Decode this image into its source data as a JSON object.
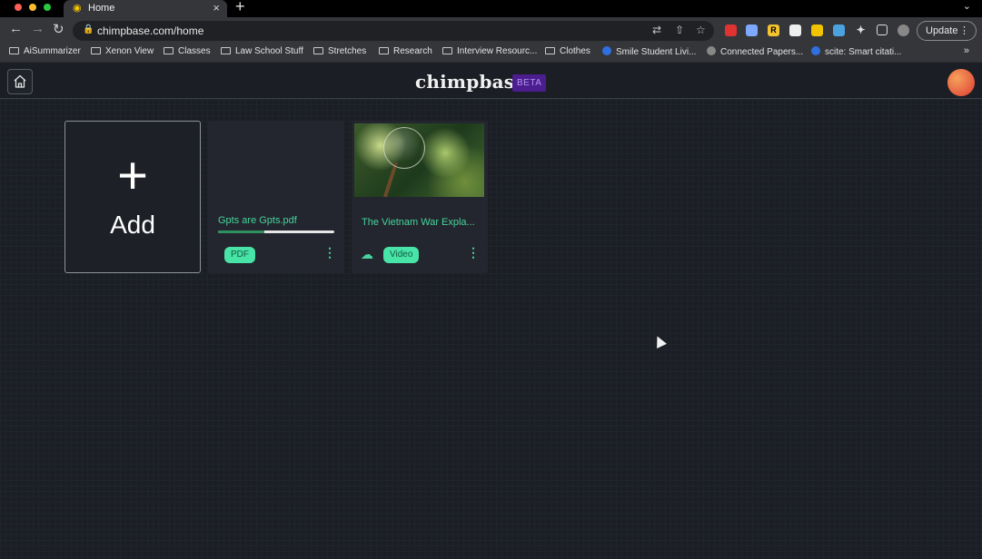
{
  "browser": {
    "tab_title": "Home",
    "tab_favicon": "chimp-favicon",
    "tab_close": "×",
    "new_tab": "+",
    "url": "chimpbase.com/home",
    "update_label": "Update",
    "bookmarks": [
      "AiSummarizer",
      "Xenon View",
      "Classes",
      "Law School Stuff",
      "Stretches",
      "Research",
      "Interview Resourc...",
      "Clothes",
      "Smile Student Livi...",
      "Connected Papers...",
      "scite: Smart citati..."
    ],
    "bookmarks_more": "»"
  },
  "app": {
    "brand": "chimpbase",
    "badge": "BETA",
    "add_card": {
      "plus": "+",
      "label": "Add"
    },
    "cards": [
      {
        "title": "Gpts are Gpts.pdf",
        "type": "PDF",
        "progress": 0.4
      },
      {
        "title": "The Vietnam War Expla...",
        "type": "Video"
      }
    ]
  },
  "colors": {
    "accent": "#46d49c",
    "badge_bg": "#48e3a6",
    "beta_bg": "#4c1d8f",
    "background": "#1b1e24"
  }
}
